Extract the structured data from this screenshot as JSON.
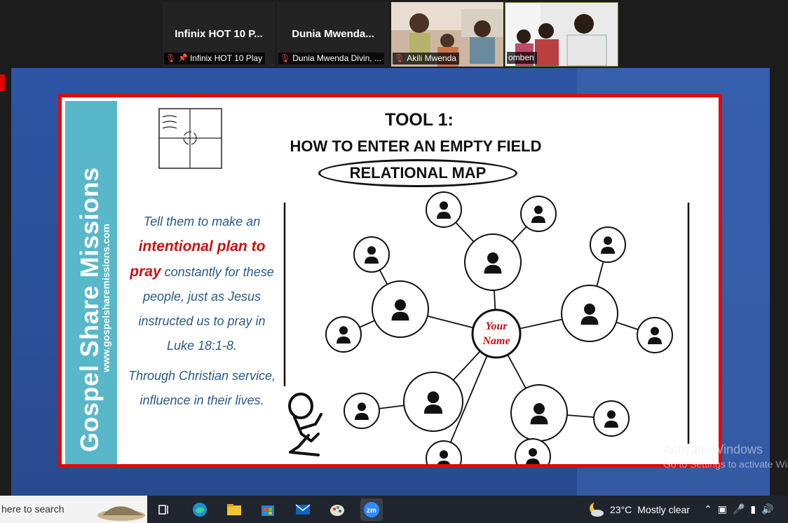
{
  "participants": [
    {
      "display_name": "Infinix HOT 10 P...",
      "caption": "Infinix HOT 10 Play"
    },
    {
      "display_name": "Dunia  Mwenda...",
      "caption": "Dunia Mwenda Divin, ..."
    },
    {
      "caption": "Akili Mwenda"
    },
    {
      "caption": "omben"
    }
  ],
  "slide": {
    "brand": "Gospel Share Missions",
    "brand_url": "www.gospelsharemissions.com",
    "title": "TOOL 1:",
    "subtitle": "HOW TO ENTER AN EMPTY FIELD",
    "map_label": "RELATIONAL MAP",
    "center_line1": "Your",
    "center_line2": "Name",
    "text1_a": "Tell them to make an",
    "text1_b": "intentional plan to",
    "text1_c": "pray",
    "text1_d": " constantly for these people, just as Jesus instructed us to pray in Luke 18:1-8.",
    "text2": "Through Christian service, influence in their lives."
  },
  "watermark": {
    "line1": "Activate Windows",
    "line2": "Go to Settings to activate Windows."
  },
  "taskbar": {
    "search_placeholder": "here to search",
    "weather_temp": "23°C",
    "weather_desc": "Mostly clear"
  },
  "colors": {
    "slide_border": "#e00a0a",
    "brand_band": "#58b7c9",
    "highlight_red": "#cc1111",
    "body_text": "#2a5a8a"
  }
}
